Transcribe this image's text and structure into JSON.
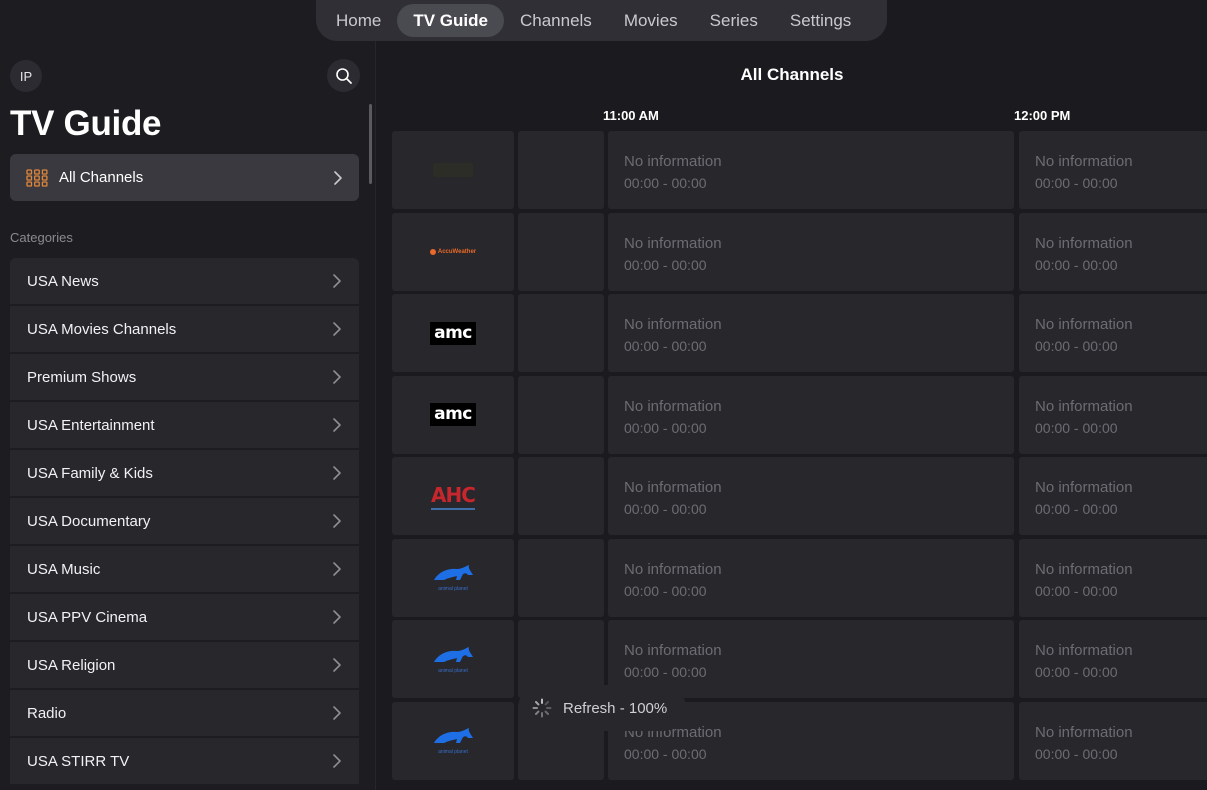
{
  "nav": {
    "tabs": [
      {
        "label": "Home",
        "active": false
      },
      {
        "label": "TV Guide",
        "active": true
      },
      {
        "label": "Channels",
        "active": false
      },
      {
        "label": "Movies",
        "active": false
      },
      {
        "label": "Series",
        "active": false
      },
      {
        "label": "Settings",
        "active": false
      }
    ]
  },
  "sidebar": {
    "avatar_initials": "IP",
    "search_icon": "search-icon",
    "title": "TV Guide",
    "all_channels_label": "All Channels",
    "categories_heading": "Categories",
    "categories": [
      {
        "label": "USA News"
      },
      {
        "label": "USA Movies Channels"
      },
      {
        "label": "Premium Shows"
      },
      {
        "label": "USA Entertainment"
      },
      {
        "label": "USA Family & Kids"
      },
      {
        "label": "USA Documentary"
      },
      {
        "label": "USA Music"
      },
      {
        "label": "USA PPV Cinema"
      },
      {
        "label": "USA Religion"
      },
      {
        "label": "Radio"
      },
      {
        "label": "USA STIRR TV"
      }
    ]
  },
  "guide": {
    "title": "All Channels",
    "times": [
      "11:00 AM",
      "12:00 PM"
    ],
    "rows": [
      {
        "logo": "faded",
        "program_a": {
          "title": "No information",
          "time": "00:00 - 00:00"
        },
        "program_b": {
          "title": "No information",
          "time": "00:00 - 00:00"
        }
      },
      {
        "logo": "accuweather",
        "logo_text": "AccuWeather",
        "program_a": {
          "title": "No information",
          "time": "00:00 - 00:00"
        },
        "program_b": {
          "title": "No information",
          "time": "00:00 - 00:00"
        }
      },
      {
        "logo": "amc",
        "logo_text": "amc",
        "program_a": {
          "title": "No information",
          "time": "00:00 - 00:00"
        },
        "program_b": {
          "title": "No information",
          "time": "00:00 - 00:00"
        }
      },
      {
        "logo": "amc",
        "logo_text": "amc",
        "program_a": {
          "title": "No information",
          "time": "00:00 - 00:00"
        },
        "program_b": {
          "title": "No information",
          "time": "00:00 - 00:00"
        }
      },
      {
        "logo": "ahc",
        "logo_text": "AHC",
        "program_a": {
          "title": "No information",
          "time": "00:00 - 00:00"
        },
        "program_b": {
          "title": "No information",
          "time": "00:00 - 00:00"
        }
      },
      {
        "logo": "animal-planet",
        "logo_text": "animal planet",
        "program_a": {
          "title": "No information",
          "time": "00:00 - 00:00"
        },
        "program_b": {
          "title": "No information",
          "time": "00:00 - 00:00"
        }
      },
      {
        "logo": "animal-planet",
        "logo_text": "animal planet",
        "program_a": {
          "title": "No information",
          "time": "00:00 - 00:00"
        },
        "program_b": {
          "title": "No information",
          "time": "00:00 - 00:00"
        }
      },
      {
        "logo": "animal-planet",
        "logo_text": "animal planet",
        "program_a": {
          "title": "No information",
          "time": "00:00 - 00:00"
        },
        "program_b": {
          "title": "No information",
          "time": "00:00 - 00:00"
        }
      }
    ]
  },
  "toast": {
    "text": "Refresh - 100%",
    "progress_percent": 100
  },
  "colors": {
    "background": "#1b1b1f",
    "cell": "#27272c",
    "accent_icon": "#e0873a",
    "muted_text": "#6c6c72"
  }
}
